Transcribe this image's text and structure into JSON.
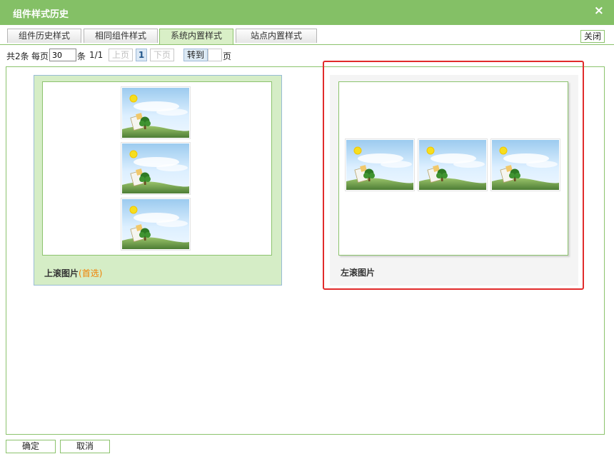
{
  "dialog": {
    "title": "组件样式历史",
    "close_icon": "×"
  },
  "tabs": [
    {
      "label": "组件历史样式"
    },
    {
      "label": "相同组件样式"
    },
    {
      "label": "系统内置样式"
    },
    {
      "label": "站点内置样式"
    }
  ],
  "active_tab": 2,
  "toolbar": {
    "close_label": "关闭"
  },
  "pager": {
    "total": "共2条",
    "per_page_label": "每页",
    "per_page_value": "30",
    "unit": "条",
    "page_info": "1/1",
    "prev": "上页",
    "current": "1",
    "next": "下页",
    "goto": "转到",
    "page_suffix": "页"
  },
  "styles": [
    {
      "label": "上滚图片",
      "preferred": "(首选)",
      "layout": "vertical",
      "thumb_count": 3
    },
    {
      "label": "左滚图片",
      "layout": "horizontal",
      "thumb_count": 3
    }
  ],
  "buttons": {
    "ok": "确定",
    "cancel": "取消"
  },
  "colors": {
    "accent": "#84c066",
    "border": "#8cc36d",
    "highlight": "#e12b2b",
    "preferred": "#f08000"
  }
}
